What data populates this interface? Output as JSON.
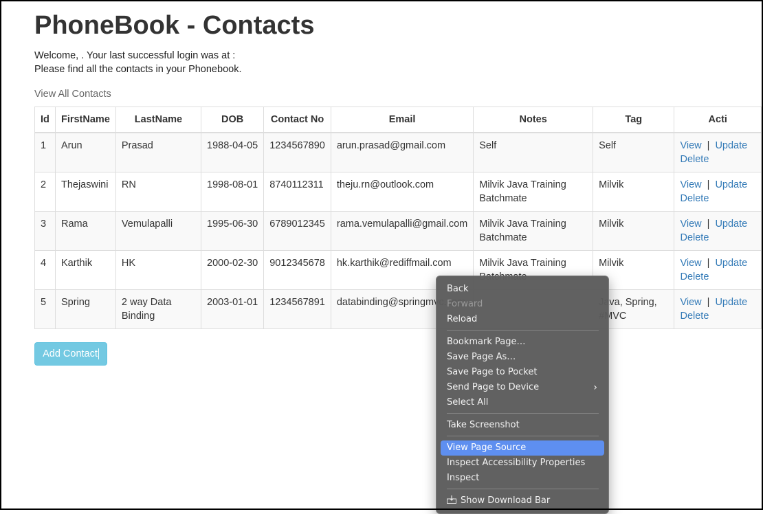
{
  "page": {
    "title": "PhoneBook - Contacts",
    "welcome_line": "Welcome, . Your last successful login was at :",
    "info_line": "Please find all the contacts in your Phonebook.",
    "view_all_label": "View All Contacts",
    "add_button_label": "Add Contact"
  },
  "table": {
    "headers": [
      "Id",
      "FirstName",
      "LastName",
      "DOB",
      "Contact No",
      "Email",
      "Notes",
      "Tag",
      "Acti"
    ],
    "rows": [
      {
        "id": "1",
        "first": "Arun",
        "last": "Prasad",
        "dob": "1988-04-05",
        "phone": "1234567890",
        "email": "arun.prasad@gmail.com",
        "notes": "Self",
        "tag": "Self"
      },
      {
        "id": "2",
        "first": "Thejaswini",
        "last": "RN",
        "dob": "1998-08-01",
        "phone": "8740112311",
        "email": "theju.rn@outlook.com",
        "notes": "Milvik Java Training Batchmate",
        "tag": "Milvik"
      },
      {
        "id": "3",
        "first": "Rama",
        "last": "Vemulapalli",
        "dob": "1995-06-30",
        "phone": "6789012345",
        "email": "rama.vemulapalli@gmail.com",
        "notes": "Milvik Java Training Batchmate",
        "tag": "Milvik"
      },
      {
        "id": "4",
        "first": "Karthik",
        "last": "HK",
        "dob": "2000-02-30",
        "phone": "9012345678",
        "email": "hk.karthik@rediffmail.com",
        "notes": "Milvik Java Training Batchmate",
        "tag": "Milvik"
      },
      {
        "id": "5",
        "first": "Spring",
        "last": "2 way Data Binding",
        "dob": "2003-01-01",
        "phone": "1234567891",
        "email": "databinding@springmvc.com",
        "notes": "",
        "tag": "Java, Spring, #MVC"
      }
    ],
    "actions": {
      "view": "View",
      "separator": "|",
      "update": "Update",
      "delete": "Delete"
    }
  },
  "context_menu": {
    "back": "Back",
    "forward": "Forward",
    "reload": "Reload",
    "bookmark": "Bookmark Page…",
    "save_as": "Save Page As…",
    "save_pocket": "Save Page to Pocket",
    "send_device": "Send Page to Device",
    "select_all": "Select All",
    "screenshot": "Take Screenshot",
    "view_source": "View Page Source",
    "inspect_a11y": "Inspect Accessibility Properties",
    "inspect": "Inspect",
    "download_bar": "Show Download Bar",
    "submenu_icon": "chevron-right-icon",
    "download_icon": "download-bar-icon",
    "highlight_color": "#5e8ff0"
  },
  "colors": {
    "link": "#337ab7",
    "button": "#5bc0de"
  }
}
